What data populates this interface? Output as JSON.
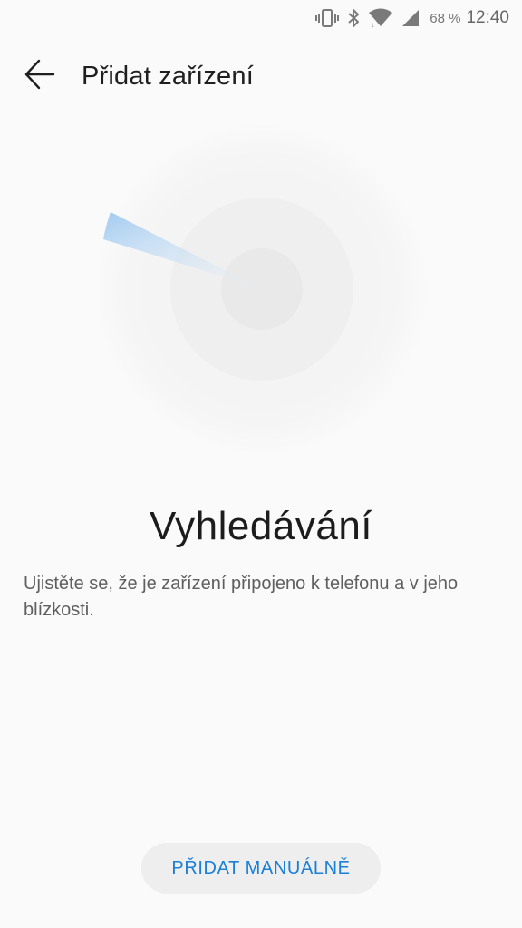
{
  "status_bar": {
    "icons": [
      "vibrate-icon",
      "bluetooth-icon",
      "wifi-icon",
      "signal-icon"
    ],
    "battery": "68 %",
    "time": "12:40"
  },
  "header": {
    "back_icon": "arrow-left-icon",
    "title": "Přidat zařízení"
  },
  "main": {
    "status_title": "Vyhledávání",
    "hint": "Ujistěte se, že je zařízení připojeno k telefonu a v jeho blízkosti."
  },
  "footer": {
    "add_manual_label": "PŘIDAT MANUÁLNĚ"
  },
  "colors": {
    "accent": "#1a7fd6",
    "radar_sweep": "#a9cff0"
  }
}
